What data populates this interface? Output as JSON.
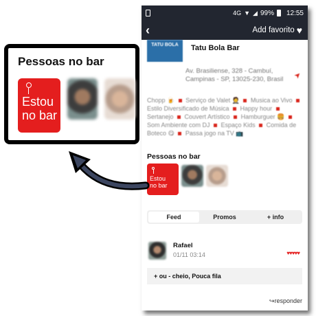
{
  "status_bar": {
    "network": "4G",
    "battery": "99%",
    "time": "12:55"
  },
  "app_bar": {
    "back_icon": "chevron-left-icon",
    "favorite_label": "Add favorito",
    "favorite_icon": "heart-icon"
  },
  "bar": {
    "logo_text": "TATU BOLA",
    "name": "Tatu Bola Bar",
    "address_line1": "Av. Brasiliense, 328 - Cambuí,",
    "address_line2": "Campinas - SP, 13025-230, Brasil",
    "tags_text": "Chopp 🍺 ■ Serviço de Valet 🤵 ■ Musica ao Vivo ■ Estilo Diversificado de Música ■ Happy hour ■ Sertanejo ■ Couvert Artístico ■ Hamburguer 🍔 ■ Som Ambiente com DJ ■ Espaço Kids ■ Comida de Boteco 😋 ■ Passa jogo na TV 📺"
  },
  "people_section": {
    "title": "Pessoas no bar",
    "estou_line1": "Estou",
    "estou_line2": "no bar"
  },
  "tabs": [
    {
      "label": "Feed",
      "active": true
    },
    {
      "label": "Promos",
      "active": false
    },
    {
      "label": "+ info",
      "active": false
    }
  ],
  "feed": {
    "user_name": "Rafael",
    "date": "01/11 03:14",
    "hearts": "♥♥♥♥♥",
    "comment": "+ ou - cheio, Pouca fila",
    "reply_label": "↪responder"
  },
  "callout": {
    "title": "Pessoas no bar",
    "estou_line1": "Estou",
    "estou_line2": "no bar"
  },
  "colors": {
    "accent_red": "#e41e1e",
    "app_bar": "#222630"
  }
}
